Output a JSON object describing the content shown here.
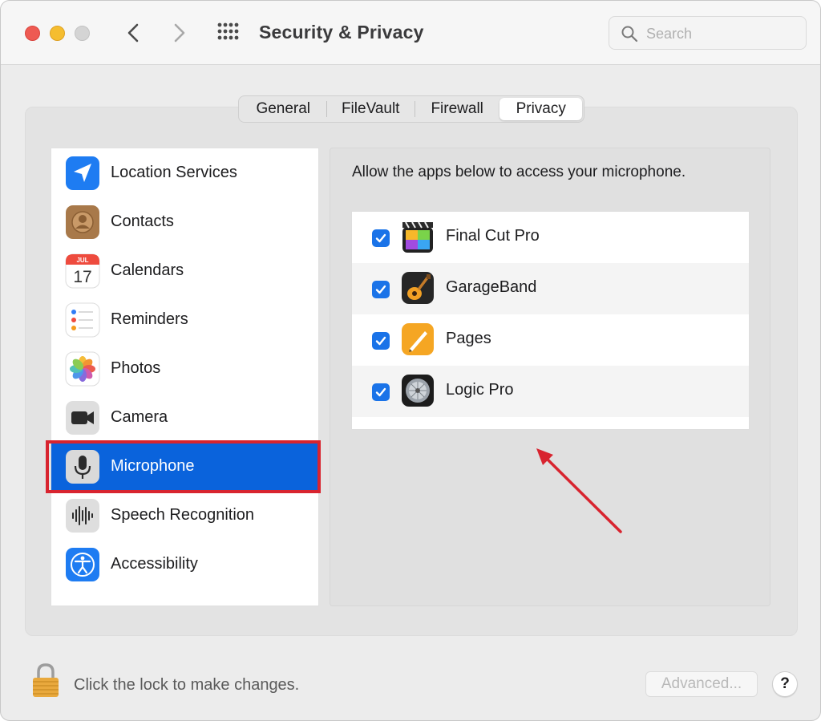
{
  "window": {
    "title": "Security & Privacy",
    "search_placeholder": "Search"
  },
  "tabs": [
    {
      "label": "General"
    },
    {
      "label": "FileVault"
    },
    {
      "label": "Firewall"
    },
    {
      "label": "Privacy",
      "selected": true
    }
  ],
  "sidebar": {
    "items": [
      {
        "label": "Location Services",
        "icon": "location-arrow-icon"
      },
      {
        "label": "Contacts",
        "icon": "contacts-icon"
      },
      {
        "label": "Calendars",
        "icon": "calendar-icon",
        "icon_month": "JUL",
        "icon_day": "17"
      },
      {
        "label": "Reminders",
        "icon": "reminders-icon"
      },
      {
        "label": "Photos",
        "icon": "photos-icon"
      },
      {
        "label": "Camera",
        "icon": "camera-icon"
      },
      {
        "label": "Microphone",
        "icon": "microphone-icon",
        "selected": true
      },
      {
        "label": "Speech Recognition",
        "icon": "speech-waveform-icon"
      },
      {
        "label": "Accessibility",
        "icon": "accessibility-icon"
      }
    ]
  },
  "main": {
    "description": "Allow the apps below to access your microphone.",
    "apps": [
      {
        "name": "Final Cut Pro",
        "checked": true,
        "icon": "final-cut-pro-icon"
      },
      {
        "name": "GarageBand",
        "checked": true,
        "icon": "garageband-icon"
      },
      {
        "name": "Pages",
        "checked": true,
        "icon": "pages-icon"
      },
      {
        "name": "Logic Pro",
        "checked": true,
        "icon": "logic-pro-icon"
      }
    ]
  },
  "footer": {
    "lock_text": "Click the lock to make changes.",
    "advanced_label": "Advanced...",
    "help_label": "?"
  },
  "colors": {
    "selection": "#0a63dc",
    "checkbox": "#1a73e8",
    "annotation": "#d8242f"
  }
}
